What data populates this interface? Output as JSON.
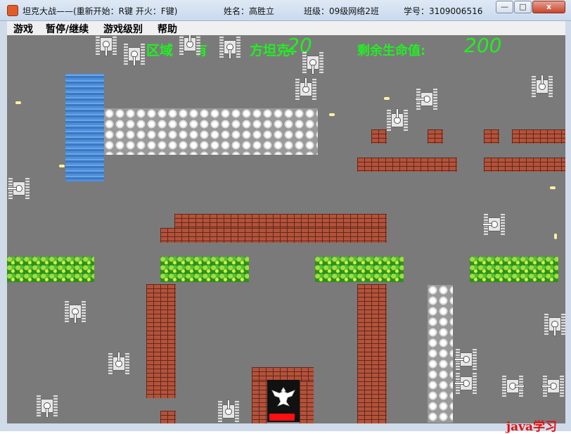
{
  "window": {
    "title": "坦克大战——(重新开始：R键  开火：F键)",
    "name_label": "姓名：高胜立",
    "class_label": "班级：09级网络2班",
    "student_id_label": "学号：3109006516",
    "minimize": "—",
    "maximize": "□",
    "close": "x"
  },
  "menu": {
    "items": [
      "游戏",
      "暂停/继续",
      "游戏级别",
      "帮助"
    ]
  },
  "hud": {
    "enemy_label": "区域",
    "enemy_label_2": "有",
    "enemy_label_3": "方坦克:",
    "enemy_count": "20",
    "life_label": "剩余生命值:",
    "life_value": "200"
  },
  "watermark": "java学习",
  "colors": {
    "hud_green": "#22ee22",
    "field_gray": "#7a7a7a",
    "brick": "#b5523a",
    "base_red": "#ff1010"
  },
  "icons": [
    "app-icon",
    "eagle-icon",
    "tank-icon"
  ]
}
